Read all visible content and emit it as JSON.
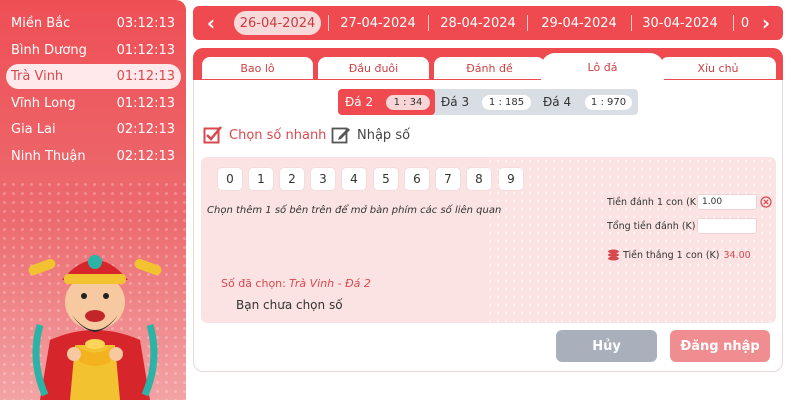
{
  "sidebar": {
    "regions": [
      {
        "name": "Miền Bắc",
        "time": "03:12:13"
      },
      {
        "name": "Bình Dương",
        "time": "01:12:13"
      },
      {
        "name": "Trà Vinh",
        "time": "01:12:13"
      },
      {
        "name": "Vĩnh Long",
        "time": "01:12:13"
      },
      {
        "name": "Gia Lai",
        "time": "02:12:13"
      },
      {
        "name": "Ninh Thuận",
        "time": "02:12:13"
      }
    ],
    "active_index": 2
  },
  "dates": {
    "items": [
      "26-04-2024",
      "27-04-2024",
      "28-04-2024",
      "29-04-2024",
      "30-04-2024"
    ],
    "partial": "0",
    "active_index": 0
  },
  "tabs": [
    "Bao lô",
    "Đầu đuôi",
    "Đánh đề",
    "Lô đá",
    "Xỉu chủ"
  ],
  "active_tab": "Lô đá",
  "subtabs": [
    {
      "name": "Đá 2",
      "ratio": "1 : 34"
    },
    {
      "name": "Đá 3",
      "ratio": "1 : 185"
    },
    {
      "name": "Đá 4",
      "ratio": "1 : 970"
    }
  ],
  "options": {
    "quick": "Chọn số nhanh",
    "manual": "Nhập số"
  },
  "digits": [
    "0",
    "1",
    "2",
    "3",
    "4",
    "5",
    "6",
    "7",
    "8",
    "9"
  ],
  "hint": "Chọn thêm 1 số bên trên để mở bàn phím các số liên quan",
  "form": {
    "bet_label": "Tiền đánh 1 con (K)",
    "bet_value": "1.00",
    "total_label": "Tổng tiền đánh (K)",
    "total_value": "",
    "win_label": "Tiền thắng 1 con (K)",
    "win_value": "34.00"
  },
  "chosen": {
    "label": "Số đã chọn:",
    "value": "Trà Vinh - Đá 2",
    "empty": "Bạn chưa chọn số"
  },
  "buttons": {
    "cancel": "Hủy",
    "login": "Đăng nhập"
  },
  "colors": {
    "primary": "#ee4a4f",
    "panel_pink": "#fbe3e3",
    "cancel_gray": "#a9b0bb",
    "login_pink": "#ef8d90"
  }
}
